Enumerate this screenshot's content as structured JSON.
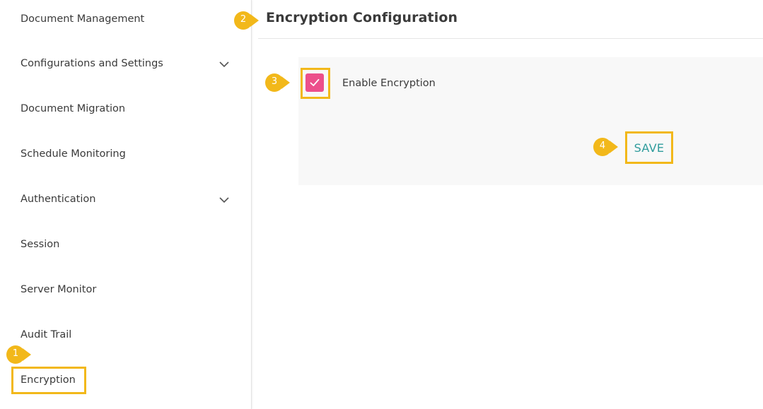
{
  "sidebar": {
    "items": [
      {
        "label": "Document Management",
        "has_chevron": false
      },
      {
        "label": "Configurations and Settings",
        "has_chevron": true
      },
      {
        "label": "Document Migration",
        "has_chevron": false
      },
      {
        "label": "Schedule Monitoring",
        "has_chevron": false
      },
      {
        "label": "Authentication",
        "has_chevron": true
      },
      {
        "label": "Session",
        "has_chevron": false
      },
      {
        "label": "Server Monitor",
        "has_chevron": false
      },
      {
        "label": "Audit Trail",
        "has_chevron": false
      },
      {
        "label": "Encryption",
        "has_chevron": false,
        "selected": true
      }
    ]
  },
  "main": {
    "title": "Encryption Configuration",
    "encryption_checkbox": {
      "label": "Enable Encryption",
      "checked": true
    },
    "save_label": "SAVE"
  },
  "annotations": {
    "step1": "1",
    "step2": "2",
    "step3": "3",
    "step4": "4"
  },
  "colors": {
    "highlight": "#f2b81a",
    "checkbox": "#ec4f8b",
    "save": "#2f9c9c",
    "marker": "#f2b81a"
  }
}
